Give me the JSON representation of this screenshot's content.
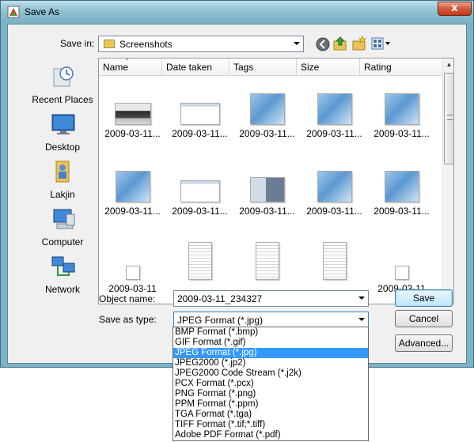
{
  "window": {
    "title": "Save As",
    "close_label": "x"
  },
  "toolbar": {
    "save_in_label": "Save in:",
    "current_folder": "Screenshots"
  },
  "places": [
    {
      "label": "Recent Places",
      "icon": "recent-places-icon"
    },
    {
      "label": "Desktop",
      "icon": "desktop-icon"
    },
    {
      "label": "Lakjin",
      "icon": "user-folder-icon"
    },
    {
      "label": "Computer",
      "icon": "computer-icon"
    },
    {
      "label": "Network",
      "icon": "network-icon"
    }
  ],
  "columns": [
    "Name",
    "Date taken",
    "Tags",
    "Size",
    "Rating"
  ],
  "files": [
    {
      "name": "2009-03-11...",
      "thumb": "dark"
    },
    {
      "name": "2009-03-11...",
      "thumb": "dialog"
    },
    {
      "name": "2009-03-11...",
      "thumb": "blue"
    },
    {
      "name": "2009-03-11...",
      "thumb": "blue"
    },
    {
      "name": "2009-03-11...",
      "thumb": "blue"
    },
    {
      "name": "2009-03-11...",
      "thumb": "blue"
    },
    {
      "name": "2009-03-11...",
      "thumb": "dialog"
    },
    {
      "name": "2009-03-11...",
      "thumb": "mix"
    },
    {
      "name": "2009-03-11...",
      "thumb": "blue"
    },
    {
      "name": "2009-03-11...",
      "thumb": "blue"
    },
    {
      "name": "2009-03-11",
      "thumb": "small"
    },
    {
      "name": "",
      "thumb": "doc"
    },
    {
      "name": "",
      "thumb": "doc"
    },
    {
      "name": "",
      "thumb": "doc"
    },
    {
      "name": "2009-03-11",
      "thumb": "small"
    }
  ],
  "form": {
    "object_name_label": "Object name:",
    "object_name_value": "2009-03-11_234327",
    "save_type_label": "Save as type:",
    "save_type_value": "JPEG Format (*.jpg)"
  },
  "buttons": {
    "save": "Save",
    "cancel": "Cancel",
    "advanced": "Advanced..."
  },
  "type_options": [
    "BMP Format (*.bmp)",
    "GIF Format (*.gif)",
    "JPEG Format (*.jpg)",
    "JPEG2000 (*.jp2)",
    "JPEG2000 Code Stream (*.j2k)",
    "PCX Format (*.pcx)",
    "PNG Format (*.png)",
    "PPM Format (*.ppm)",
    "TGA Format (*.tga)",
    "TIFF Format (*.tif;*.tiff)",
    "Adobe PDF Format (*.pdf)"
  ],
  "selected_type_index": 2,
  "colors": {
    "selection": "#3399ff",
    "titlebar": "#8fc2d2",
    "close_button": "#c0391b"
  }
}
